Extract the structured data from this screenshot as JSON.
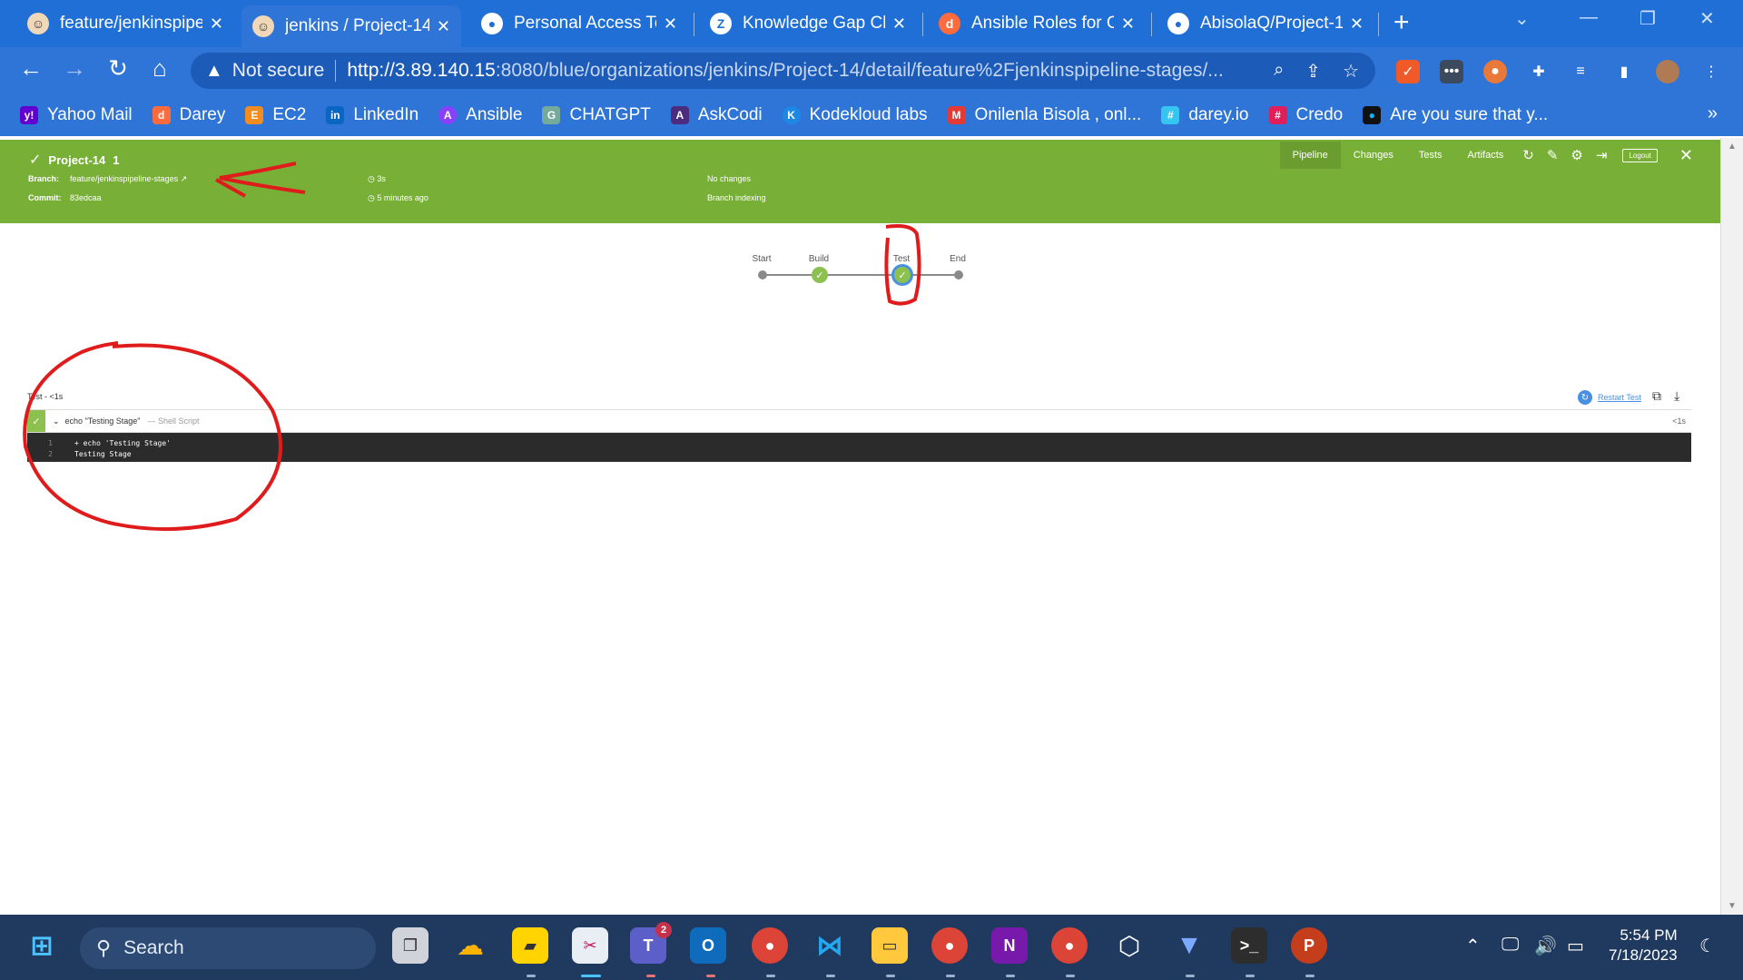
{
  "browser": {
    "tabs": [
      {
        "title": "feature/jenkinspipe",
        "icon_color": "#f0d7b8",
        "icon": "jenkins-icon"
      },
      {
        "title": "jenkins / Project-14",
        "icon_color": "#f0d7b8",
        "icon": "jenkins-icon",
        "active": true
      },
      {
        "title": "Personal Access Tok",
        "icon_color": "#ffffff",
        "icon": "github-icon"
      },
      {
        "title": "Knowledge Gap Cla",
        "icon_color": "#ffffff",
        "icon": "zoho-icon"
      },
      {
        "title": "Ansible Roles for Cl",
        "icon_color": "#ff6b3d",
        "icon": "darey-icon"
      },
      {
        "title": "AbisolaQ/Project-1",
        "icon_color": "#ffffff",
        "icon": "github-icon"
      }
    ],
    "close_glyph": "✕",
    "new_tab_glyph": "+",
    "address": {
      "security": "Not secure",
      "url_host": "http://3.89.140.15",
      "url_rest": ":8080/blue/organizations/jenkins/Project-14/detail/feature%2Fjenkinspipeline-stages/..."
    },
    "bookmarks": [
      {
        "label": "Yahoo Mail",
        "color": "#6001d2",
        "glyph": "y!"
      },
      {
        "label": "Darey",
        "color": "#ff6b3d",
        "glyph": "d"
      },
      {
        "label": "EC2",
        "color": "#f28b20",
        "glyph": "E"
      },
      {
        "label": "LinkedIn",
        "color": "#0a66c2",
        "glyph": "in"
      },
      {
        "label": "Ansible",
        "color": "#8a3ffc",
        "glyph": "A"
      },
      {
        "label": "CHATGPT",
        "color": "#74aa9c",
        "glyph": "G"
      },
      {
        "label": "AskCodi",
        "color": "#4b2c7f",
        "glyph": "A"
      },
      {
        "label": "Kodekloud labs",
        "color": "#1e88e5",
        "glyph": "K"
      },
      {
        "label": "Onilenla Bisola , onl...",
        "color": "#e53935",
        "glyph": "M"
      },
      {
        "label": "darey.io",
        "color": "#36c5f0",
        "glyph": "#"
      },
      {
        "label": "Credo",
        "color": "#e01e5a",
        "glyph": "#"
      },
      {
        "label": "Are you sure that y...",
        "color": "#00b4ff",
        "glyph": "●"
      }
    ],
    "bookmarks_more": "»"
  },
  "jenkins": {
    "title": "Project-14",
    "run_number": "1",
    "branch_label": "Branch:",
    "branch": "feature/jenkinspipeline-stages",
    "commit_label": "Commit:",
    "commit": "83edcaa",
    "duration": "3s",
    "started": "5 minutes ago",
    "changes": "No changes",
    "cause": "Branch indexing",
    "nav": [
      "Pipeline",
      "Changes",
      "Tests",
      "Artifacts"
    ],
    "logout": "Logout",
    "header_color": "#78b037",
    "stages": [
      "Start",
      "Build",
      "Test",
      "End"
    ],
    "log_title": "Test - <1s",
    "restart_label": "Restart Test",
    "step": {
      "name": "echo \"Testing Stage\"",
      "type": "— Shell Script",
      "duration": "<1s"
    },
    "console_lines": [
      {
        "n": "1",
        "text": "+ echo 'Testing Stage'"
      },
      {
        "n": "2",
        "text": "Testing Stage"
      }
    ]
  },
  "taskbar": {
    "search": "Search",
    "time": "5:54 PM",
    "date": "7/18/2023",
    "teams_badge": "2"
  }
}
